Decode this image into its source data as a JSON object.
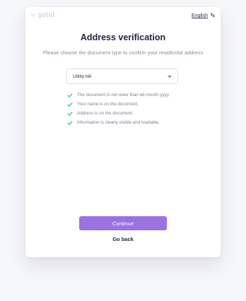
{
  "brand": {
    "prefix": "by",
    "name": "getid"
  },
  "language": {
    "label": "English"
  },
  "header": {
    "title": "Address verification",
    "subtitle": "Please choose the document type to confirm your residential address"
  },
  "document_select": {
    "value": "Utility bill"
  },
  "requirements": [
    "The document is not older than dd-month-yyyy.",
    "Your name is on the document.",
    "Address is on the document.",
    "Information is clearly visible and readable."
  ],
  "actions": {
    "continue_label": "Continue",
    "back_label": "Go back"
  },
  "colors": {
    "accent": "#9b72e2",
    "check": "#2fbf8f",
    "title": "#1f2340"
  }
}
